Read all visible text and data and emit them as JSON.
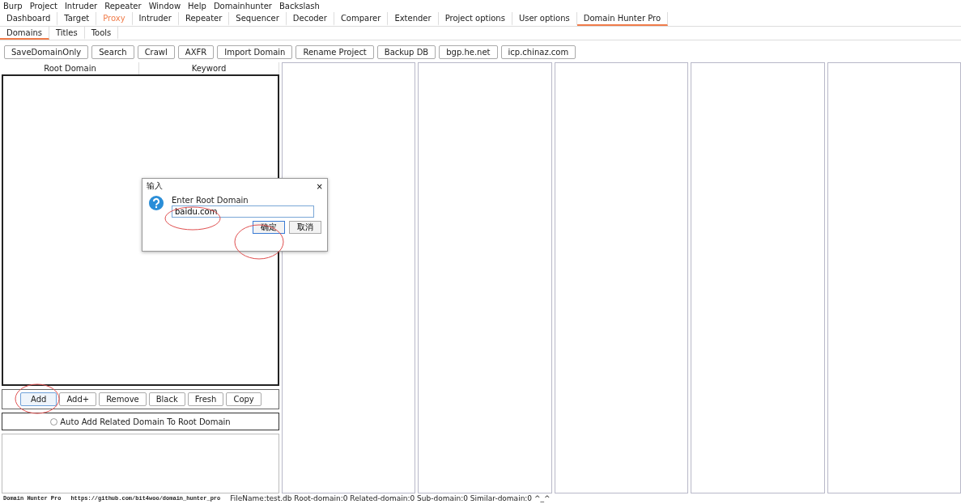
{
  "menu": [
    "Burp",
    "Project",
    "Intruder",
    "Repeater",
    "Window",
    "Help",
    "Domainhunter",
    "Backslash"
  ],
  "tabs": [
    {
      "label": "Dashboard",
      "selected": false,
      "highlighted": false
    },
    {
      "label": "Target",
      "selected": false,
      "highlighted": false
    },
    {
      "label": "Proxy",
      "selected": false,
      "highlighted": true
    },
    {
      "label": "Intruder",
      "selected": false,
      "highlighted": false
    },
    {
      "label": "Repeater",
      "selected": false,
      "highlighted": false
    },
    {
      "label": "Sequencer",
      "selected": false,
      "highlighted": false
    },
    {
      "label": "Decoder",
      "selected": false,
      "highlighted": false
    },
    {
      "label": "Comparer",
      "selected": false,
      "highlighted": false
    },
    {
      "label": "Extender",
      "selected": false,
      "highlighted": false
    },
    {
      "label": "Project options",
      "selected": false,
      "highlighted": false
    },
    {
      "label": "User options",
      "selected": false,
      "highlighted": false
    },
    {
      "label": "Domain Hunter Pro",
      "selected": true,
      "highlighted": false
    }
  ],
  "subtabs": [
    {
      "label": "Domains",
      "selected": true
    },
    {
      "label": "Titles",
      "selected": false
    },
    {
      "label": "Tools",
      "selected": false
    }
  ],
  "toolbar": [
    "SaveDomainOnly",
    "Search",
    "Crawl",
    "AXFR",
    "Import Domain",
    "Rename Project",
    "Backup DB",
    "bgp.he.net",
    "icp.chinaz.com"
  ],
  "domain_table": {
    "columns": [
      "Root Domain",
      "Keyword"
    ]
  },
  "domain_buttons": [
    {
      "label": "Add",
      "focused": true
    },
    {
      "label": "Add+",
      "focused": false
    },
    {
      "label": "Remove",
      "focused": false
    },
    {
      "label": "Black",
      "focused": false
    },
    {
      "label": "Fresh",
      "focused": false
    },
    {
      "label": "Copy",
      "focused": false
    }
  ],
  "auto_add": {
    "label": "Auto Add Related Domain To Root Domain",
    "checked": false
  },
  "dialog": {
    "title": "输入",
    "close": "×",
    "message": "Enter Root Domain",
    "value": "baidu.com",
    "buttons": [
      {
        "label": "确定",
        "default": true
      },
      {
        "label": "取消",
        "default": false
      }
    ]
  },
  "status_bar": {
    "app_name": "Domain Hunter Pro",
    "url": "https://github.com/bit4woo/domain_hunter_pro",
    "info": "FileName:test.db  Root-domain:0  Related-domain:0  Sub-domain:0  Similar-domain:0  ^_^"
  }
}
